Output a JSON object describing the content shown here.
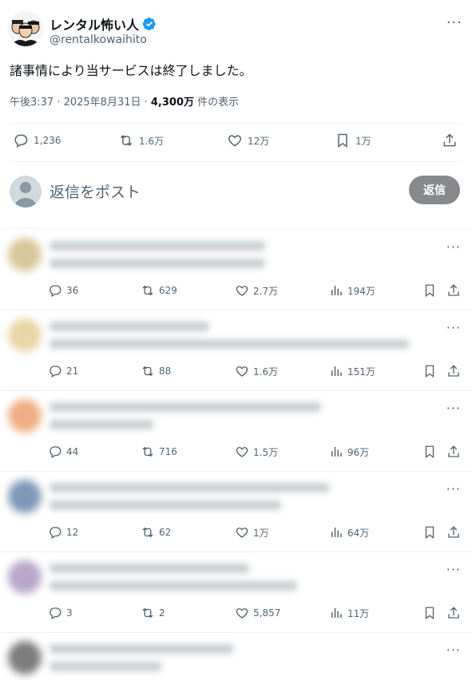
{
  "tweet": {
    "display_name": "レンタル怖い人",
    "handle": "@rentalkowaihito",
    "text": "諸事情により当サービスは終了しました。",
    "time": "午後3:37 · 2025年8月31日 · ",
    "views_count": "4,300万",
    "views_suffix": " 件の表示",
    "more_glyph": "···"
  },
  "actions": {
    "replies": "1,236",
    "reposts": "1.6万",
    "likes": "12万",
    "bookmarks": "1万"
  },
  "reply_box": {
    "placeholder": "返信をポスト",
    "button_label": "返信"
  },
  "replies": [
    {
      "replies": "36",
      "reposts": "629",
      "likes": "2.7万",
      "views": "194万"
    },
    {
      "replies": "21",
      "reposts": "88",
      "likes": "1.6万",
      "views": "151万"
    },
    {
      "replies": "44",
      "reposts": "716",
      "likes": "1.5万",
      "views": "96万"
    },
    {
      "replies": "12",
      "reposts": "62",
      "likes": "1万",
      "views": "64万"
    },
    {
      "replies": "3",
      "reposts": "2",
      "likes": "5,857",
      "views": "11万"
    }
  ],
  "colors": {
    "text": "#0f1419",
    "secondary": "#536471",
    "verified": "#1d9bf0",
    "reply_button": "#87898c",
    "divider": "#eff3f4"
  }
}
